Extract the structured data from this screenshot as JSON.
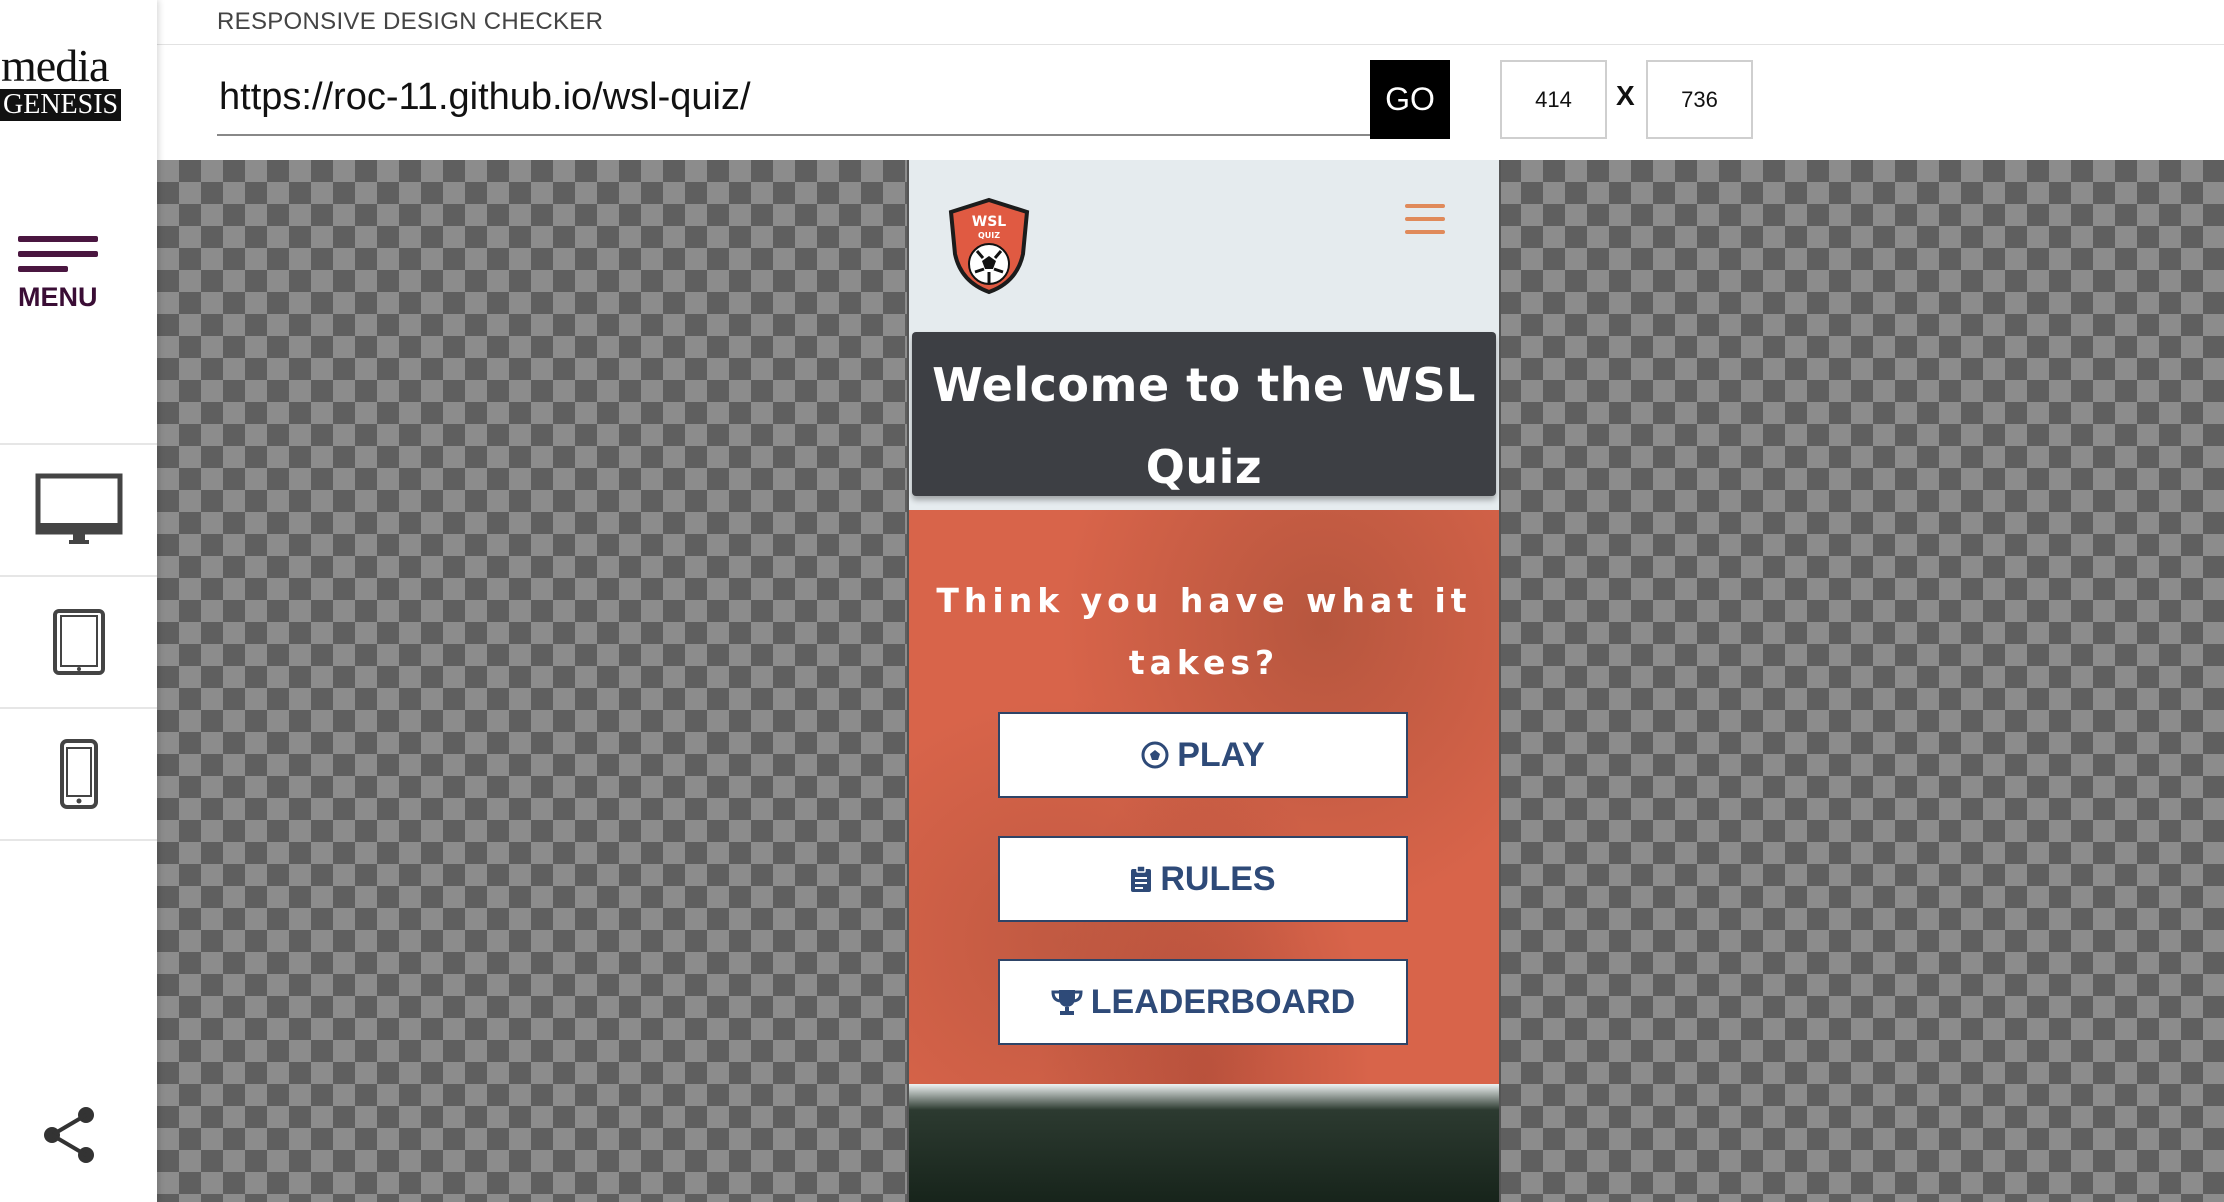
{
  "app": {
    "title": "RESPONSIVE DESIGN CHECKER",
    "logo_word": "media",
    "logo_word2": "GENESIS"
  },
  "sidebar": {
    "menu_label": "MENU",
    "devices": [
      {
        "name": "desktop-icon"
      },
      {
        "name": "tablet-icon"
      },
      {
        "name": "phone-icon"
      }
    ],
    "share_icon": "share-icon"
  },
  "toolbar": {
    "url": "https://roc-11.github.io/wsl-quiz/",
    "go_label": "GO",
    "width_value": "414",
    "height_value": "736",
    "separator": "X"
  },
  "site": {
    "logo_text_top": "WSL",
    "logo_text_bottom": "QUIZ",
    "welcome_line1": "Welcome to the WSL",
    "welcome_line2": "Quiz",
    "tagline_line1": "Think you have what it",
    "tagline_line2": "takes?",
    "buttons": {
      "play": "PLAY",
      "rules": "RULES",
      "leaderboard": "LEADERBOARD"
    },
    "colors": {
      "accent": "#e08a5a",
      "hero": "#d8644a",
      "button_text": "#2e4a78",
      "dark_panel": "#3d3f44"
    }
  }
}
